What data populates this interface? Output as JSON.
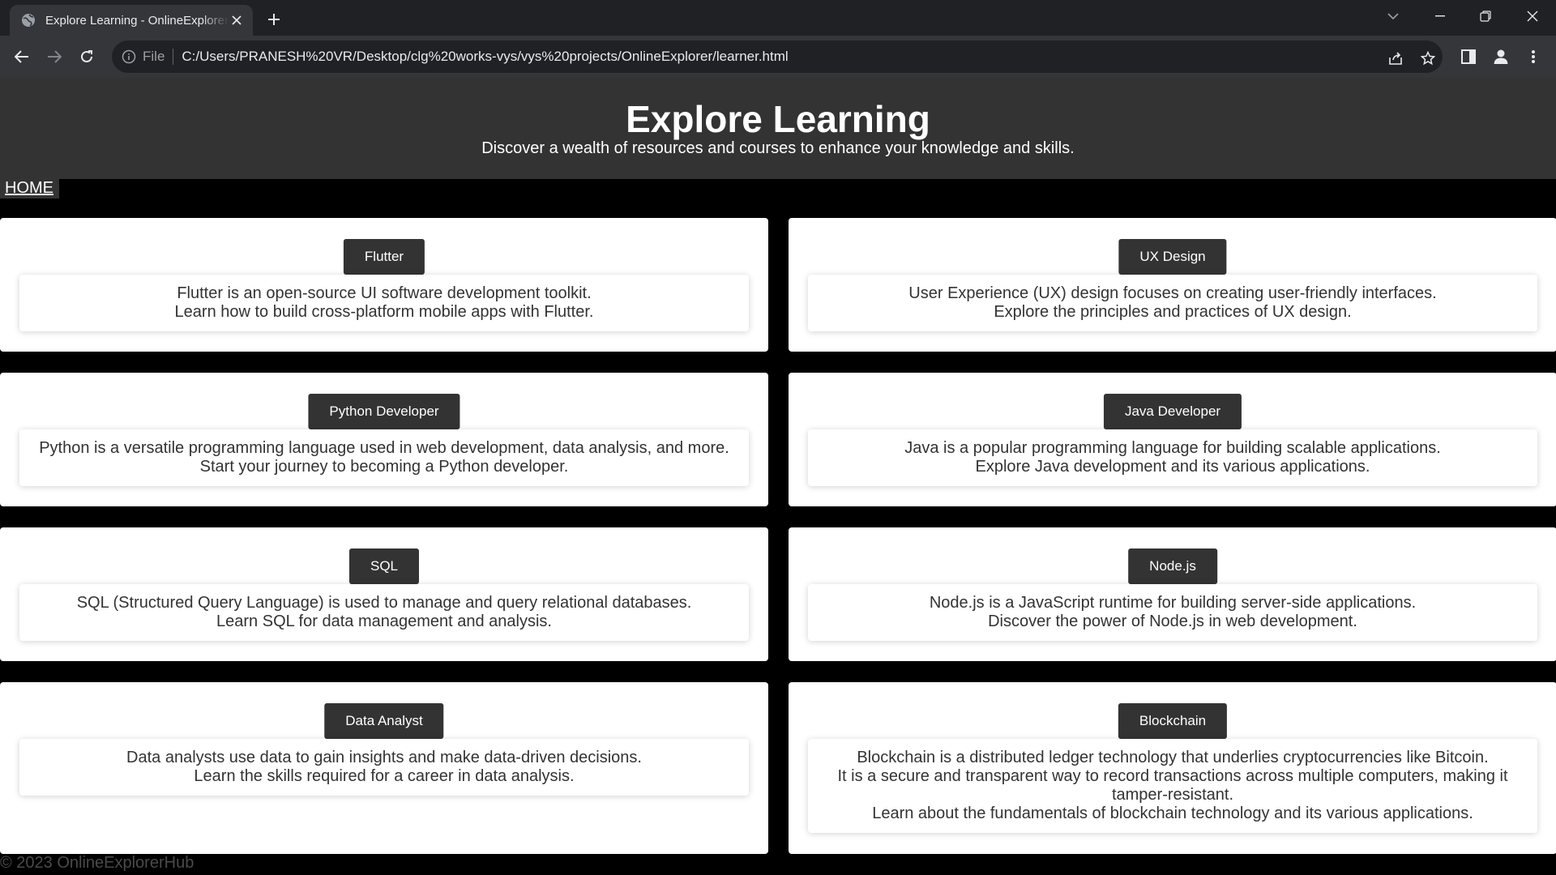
{
  "browser": {
    "tab_title": "Explore Learning - OnlineExplorerHub",
    "file_label": "File",
    "url": "C:/Users/PRANESH%20VR/Desktop/clg%20works-vys/vys%20projects/OnlineExplorer/learner.html"
  },
  "header": {
    "title": "Explore Learning",
    "subtitle": "Discover a wealth of resources and courses to enhance your knowledge and skills."
  },
  "nav": {
    "home": "HOME"
  },
  "cards": [
    {
      "title": "Flutter",
      "lines": [
        "Flutter is an open-source UI software development toolkit.",
        "Learn how to build cross-platform mobile apps with Flutter."
      ]
    },
    {
      "title": "UX Design",
      "lines": [
        "User Experience (UX) design focuses on creating user-friendly interfaces.",
        "Explore the principles and practices of UX design."
      ]
    },
    {
      "title": "Python Developer",
      "lines": [
        "Python is a versatile programming language used in web development, data analysis, and more.",
        "Start your journey to becoming a Python developer."
      ]
    },
    {
      "title": "Java Developer",
      "lines": [
        "Java is a popular programming language for building scalable applications.",
        "Explore Java development and its various applications."
      ]
    },
    {
      "title": "SQL",
      "lines": [
        "SQL (Structured Query Language) is used to manage and query relational databases.",
        "Learn SQL for data management and analysis."
      ]
    },
    {
      "title": "Node.js",
      "lines": [
        "Node.js is a JavaScript runtime for building server-side applications.",
        "Discover the power of Node.js in web development."
      ]
    },
    {
      "title": "Data Analyst",
      "lines": [
        "Data analysts use data to gain insights and make data-driven decisions.",
        "Learn the skills required for a career in data analysis."
      ]
    },
    {
      "title": "Blockchain",
      "lines": [
        "Blockchain is a distributed ledger technology that underlies cryptocurrencies like Bitcoin.",
        "It is a secure and transparent way to record transactions across multiple computers, making it tamper-resistant.",
        "Learn about the fundamentals of blockchain technology and its various applications."
      ]
    }
  ],
  "footer": {
    "text": "© 2023 OnlineExplorerHub"
  },
  "colors": {
    "header_bg": "#333333",
    "page_bg": "#000000",
    "card_bg": "#ffffff"
  }
}
